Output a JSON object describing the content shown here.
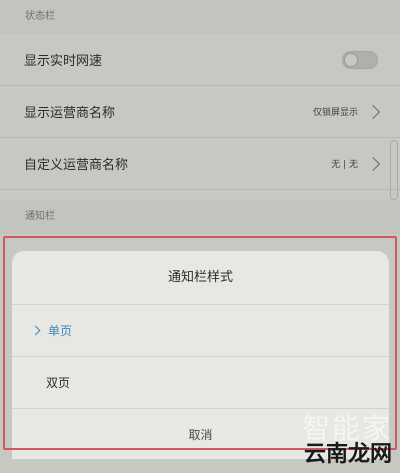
{
  "status_bar_section": {
    "header": "状态栏",
    "items": [
      {
        "label": "显示实时网速",
        "value": "",
        "toggle": "off"
      },
      {
        "label": "显示运营商名称",
        "value": "仅锁屏显示"
      },
      {
        "label": "自定义运营商名称",
        "value": "无 | 无"
      }
    ]
  },
  "notification_section": {
    "header": "通知栏"
  },
  "dialog": {
    "title": "通知栏样式",
    "options": [
      {
        "label": "单页",
        "selected": true
      },
      {
        "label": "双页",
        "selected": false
      }
    ],
    "cancel_label": "取消"
  },
  "watermark": {
    "top": "智能家",
    "bottom": "云南龙网"
  },
  "colors": {
    "accent": "#3a88b9",
    "highlight_border": "#d05a60"
  }
}
